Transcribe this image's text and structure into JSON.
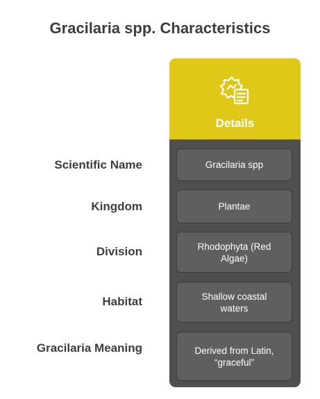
{
  "title": "Gracilaria spp. Characteristics",
  "column": {
    "header": "Details",
    "icon": "badge-document-icon",
    "colors": {
      "header_bg": "#e0c818",
      "body_bg": "#4f4f4f",
      "cell_bg": "#5f5f5f"
    }
  },
  "rows": [
    {
      "label": "Scientific Name",
      "value": "Gracilaria spp"
    },
    {
      "label": "Kingdom",
      "value": "Plantae"
    },
    {
      "label": "Division",
      "value": "Rhodophyta (Red Algae)"
    },
    {
      "label": "Habitat",
      "value": "Shallow coastal waters"
    },
    {
      "label": "Gracilaria Meaning",
      "value": "Derived from Latin, “graceful”"
    }
  ]
}
